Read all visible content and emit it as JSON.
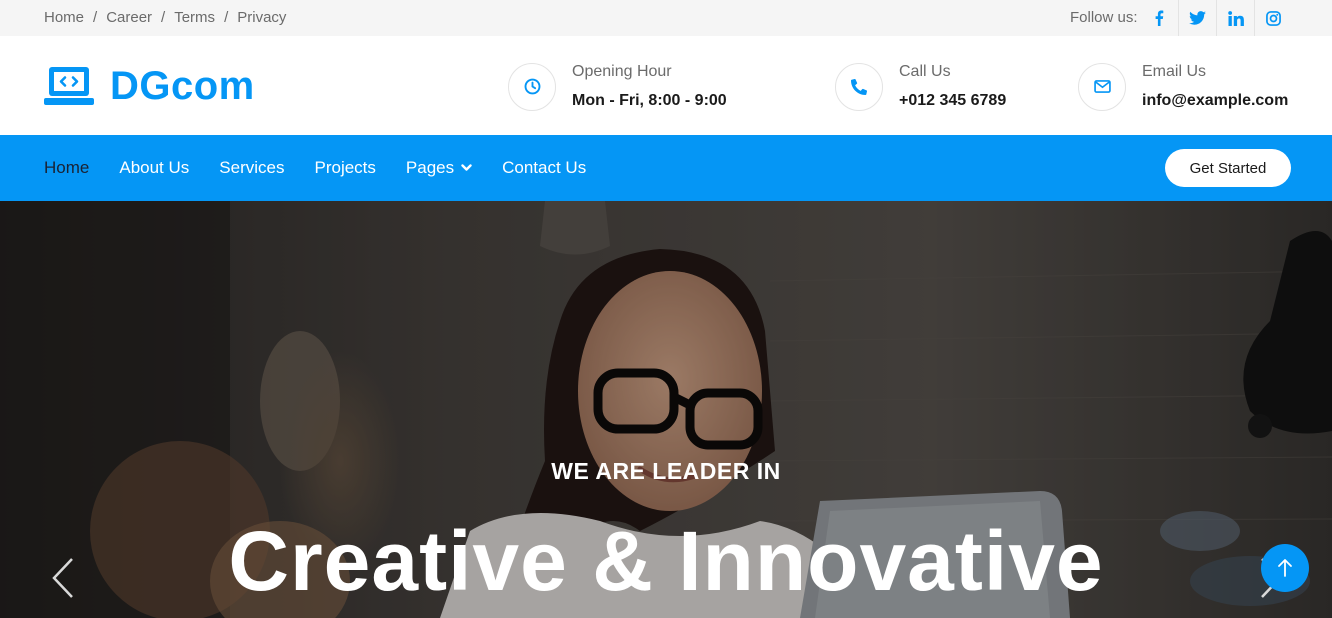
{
  "topbar": {
    "links": [
      "Home",
      "Career",
      "Terms",
      "Privacy"
    ],
    "follow_label": "Follow us:",
    "socials": [
      "facebook-icon",
      "twitter-icon",
      "linkedin-icon",
      "instagram-icon"
    ]
  },
  "brand": {
    "name": "DGcom",
    "icon": "laptop-code-icon"
  },
  "contact": {
    "opening": {
      "label": "Opening Hour",
      "value": "Mon - Fri, 8:00 - 9:00",
      "icon": "clock-icon"
    },
    "call": {
      "label": "Call Us",
      "value": "+012 345 6789",
      "icon": "phone-icon"
    },
    "email": {
      "label": "Email Us",
      "value": "info@example.com",
      "icon": "envelope-icon"
    }
  },
  "nav": {
    "items": [
      "Home",
      "About Us",
      "Services",
      "Projects",
      "Pages",
      "Contact Us"
    ],
    "active": "Home",
    "cta": "Get Started"
  },
  "hero": {
    "subtitle": "WE ARE LEADER IN",
    "title": "Creative & Innovative"
  },
  "colors": {
    "accent": "#0596f5",
    "nav_active": "#1a2233",
    "topbar_bg": "#f5f5f5"
  }
}
